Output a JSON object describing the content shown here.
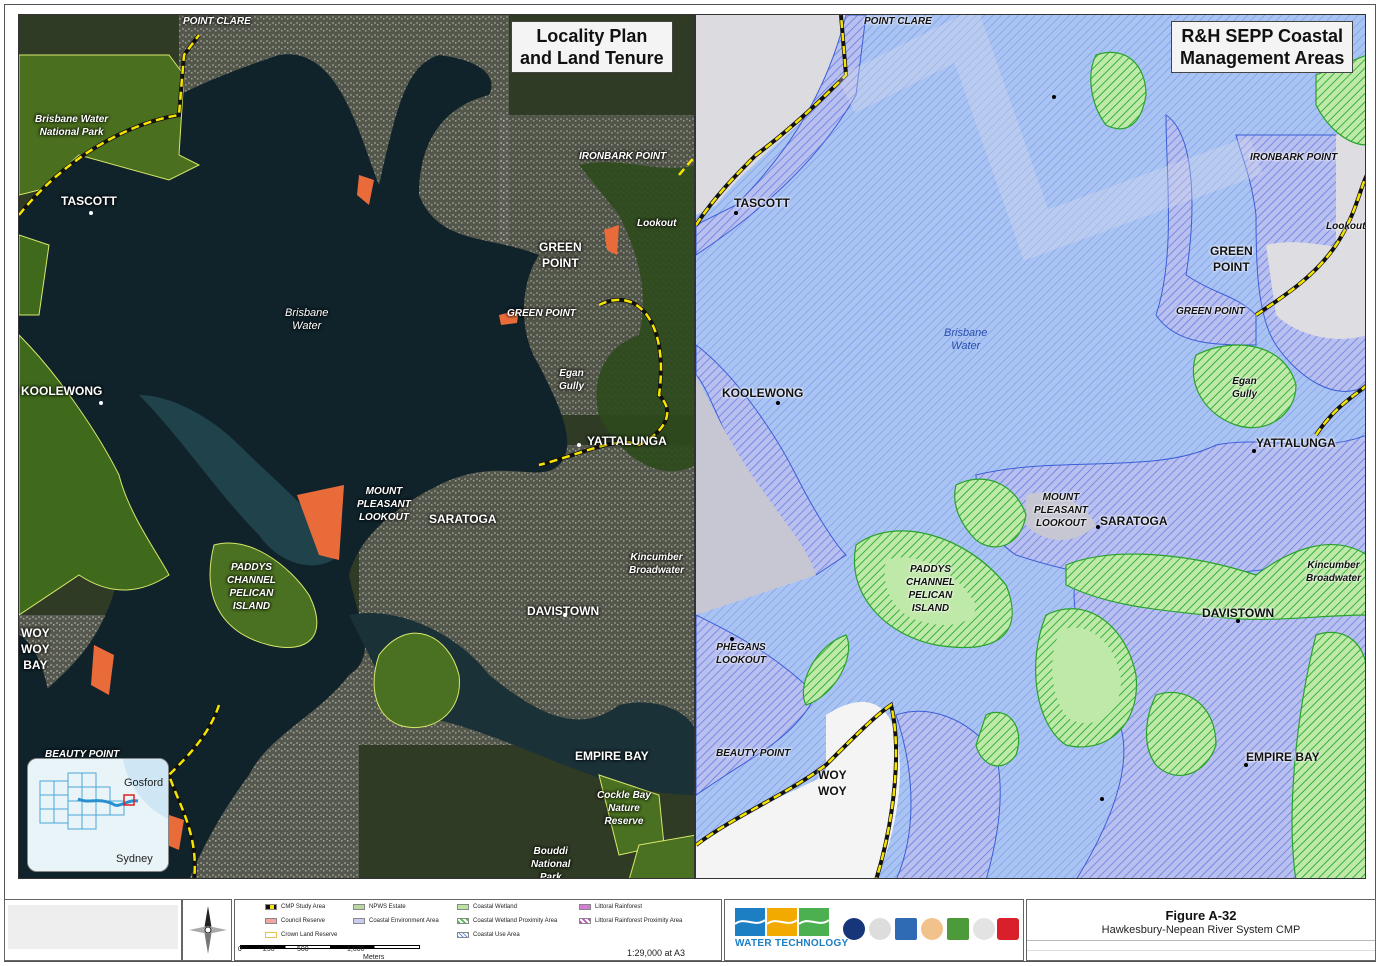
{
  "left_panel": {
    "title": "Locality Plan\nand Land Tenure",
    "labels": [
      {
        "id": "point-clare",
        "text": "POINT CLARE",
        "kind": "small"
      },
      {
        "id": "brisbane-water-np",
        "text": "Brisbane Water\nNational Park",
        "kind": "small"
      },
      {
        "id": "tascott",
        "text": "TASCOTT",
        "kind": "town"
      },
      {
        "id": "ironbark-point",
        "text": "IRONBARK POINT",
        "kind": "small"
      },
      {
        "id": "lookout",
        "text": "Lookout",
        "kind": "small"
      },
      {
        "id": "green-point-town",
        "text": "GREEN\nPOINT",
        "kind": "town"
      },
      {
        "id": "green-point",
        "text": "GREEN POINT",
        "kind": "small"
      },
      {
        "id": "brisbane-water",
        "text": "Brisbane\nWater",
        "kind": "water"
      },
      {
        "id": "koolewong",
        "text": "KOOLEWONG",
        "kind": "town"
      },
      {
        "id": "egan-gully",
        "text": "Egan\nGully",
        "kind": "small"
      },
      {
        "id": "yattalunga",
        "text": "YATTALUNGA",
        "kind": "town"
      },
      {
        "id": "mount-pleasant",
        "text": "MOUNT\nPLEASANT\nLOOKOUT",
        "kind": "small"
      },
      {
        "id": "saratoga",
        "text": "SARATOGA",
        "kind": "town"
      },
      {
        "id": "kincumber",
        "text": "Kincumber\nBroadwater",
        "kind": "small"
      },
      {
        "id": "paddys",
        "text": "PADDYS\nCHANNEL\nPELICAN\nISLAND",
        "kind": "small"
      },
      {
        "id": "davistown",
        "text": "DAVISTOWN",
        "kind": "town"
      },
      {
        "id": "woy-woy-bay",
        "text": "WOY\nWOY\nBAY",
        "kind": "town"
      },
      {
        "id": "beauty-point",
        "text": "BEAUTY POINT",
        "kind": "small"
      },
      {
        "id": "empire-bay",
        "text": "EMPIRE BAY",
        "kind": "town"
      },
      {
        "id": "cockle-bay",
        "text": "Cockle Bay\nNature\nReserve",
        "kind": "small"
      },
      {
        "id": "bouddi",
        "text": "Bouddi\nNational\nPark",
        "kind": "small"
      }
    ],
    "inset": {
      "gosford": "Gosford",
      "sydney": "Sydney"
    }
  },
  "right_panel": {
    "title": "R&H SEPP Coastal\nManagement Areas",
    "labels": [
      {
        "id": "point-clare",
        "text": "POINT CLARE",
        "kind": "small"
      },
      {
        "id": "tascott",
        "text": "TASCOTT",
        "kind": "town"
      },
      {
        "id": "ironbark-point",
        "text": "IRONBARK POINT",
        "kind": "small"
      },
      {
        "id": "lookout",
        "text": "Lookout",
        "kind": "small"
      },
      {
        "id": "green-point-town",
        "text": "GREEN\nPOINT",
        "kind": "town"
      },
      {
        "id": "green-point",
        "text": "GREEN POINT",
        "kind": "small"
      },
      {
        "id": "brisbane-water",
        "text": "Brisbane\nWater",
        "kind": "water"
      },
      {
        "id": "koolewong",
        "text": "KOOLEWONG",
        "kind": "town"
      },
      {
        "id": "egan-gully",
        "text": "Egan\nGully",
        "kind": "small"
      },
      {
        "id": "yattalunga",
        "text": "YATTALUNGA",
        "kind": "town"
      },
      {
        "id": "mount-pleasant",
        "text": "MOUNT\nPLEASANT\nLOOKOUT",
        "kind": "small"
      },
      {
        "id": "saratoga",
        "text": "SARATOGA",
        "kind": "town"
      },
      {
        "id": "kincumber",
        "text": "Kincumber\nBroadwater",
        "kind": "small"
      },
      {
        "id": "paddys",
        "text": "PADDYS\nCHANNEL\nPELICAN\nISLAND",
        "kind": "small"
      },
      {
        "id": "davistown",
        "text": "DAVISTOWN",
        "kind": "town"
      },
      {
        "id": "phegans",
        "text": "PHEGANS\nLOOKOUT",
        "kind": "small"
      },
      {
        "id": "beauty-point",
        "text": "BEAUTY POINT",
        "kind": "small"
      },
      {
        "id": "woy-woy",
        "text": "WOY\nWOY",
        "kind": "town"
      },
      {
        "id": "empire-bay",
        "text": "EMPIRE BAY",
        "kind": "town"
      }
    ]
  },
  "legend": {
    "items": [
      {
        "id": "cmp-study-area",
        "label": "CMP Study Area",
        "color": "#f5e400"
      },
      {
        "id": "council-reserve",
        "label": "Council Reserve",
        "color": "#f2a6a6"
      },
      {
        "id": "crown-land-reserve",
        "label": "Crown Land Reserve",
        "color": "#e8c15a"
      },
      {
        "id": "npws-estate",
        "label": "NPWS Estate",
        "color": "#b9d8a6"
      },
      {
        "id": "coastal-environment-area",
        "label": "Coastal Environment Area",
        "color": "#c9cdf2"
      },
      {
        "id": "coastal-wetland",
        "label": "Coastal Wetland",
        "color": "#b8e6a0"
      },
      {
        "id": "coastal-wetland-proximity",
        "label": "Coastal Wetland Proximity Area",
        "color": "#4cbf4c"
      },
      {
        "id": "coastal-use-area",
        "label": "Coastal Use Area",
        "color": "#6a8fe6"
      },
      {
        "id": "littoral-rainforest",
        "label": "Littoral Rainforest",
        "color": "#d27fd2"
      },
      {
        "id": "littoral-rainforest-proximity",
        "label": "Littoral Rainforest Proximity Area",
        "color": "#c04fc0"
      }
    ],
    "scale_ticks": [
      "0",
      "250",
      "500",
      "1,000"
    ],
    "scale_unit": "Meters",
    "scale_text": "1:29,000 at A3"
  },
  "logo": {
    "name": "WATER TECHNOLOGY"
  },
  "figure": {
    "title": "Figure A-32",
    "subtitle": "Hawkesbury-Nepean River System CMP"
  }
}
